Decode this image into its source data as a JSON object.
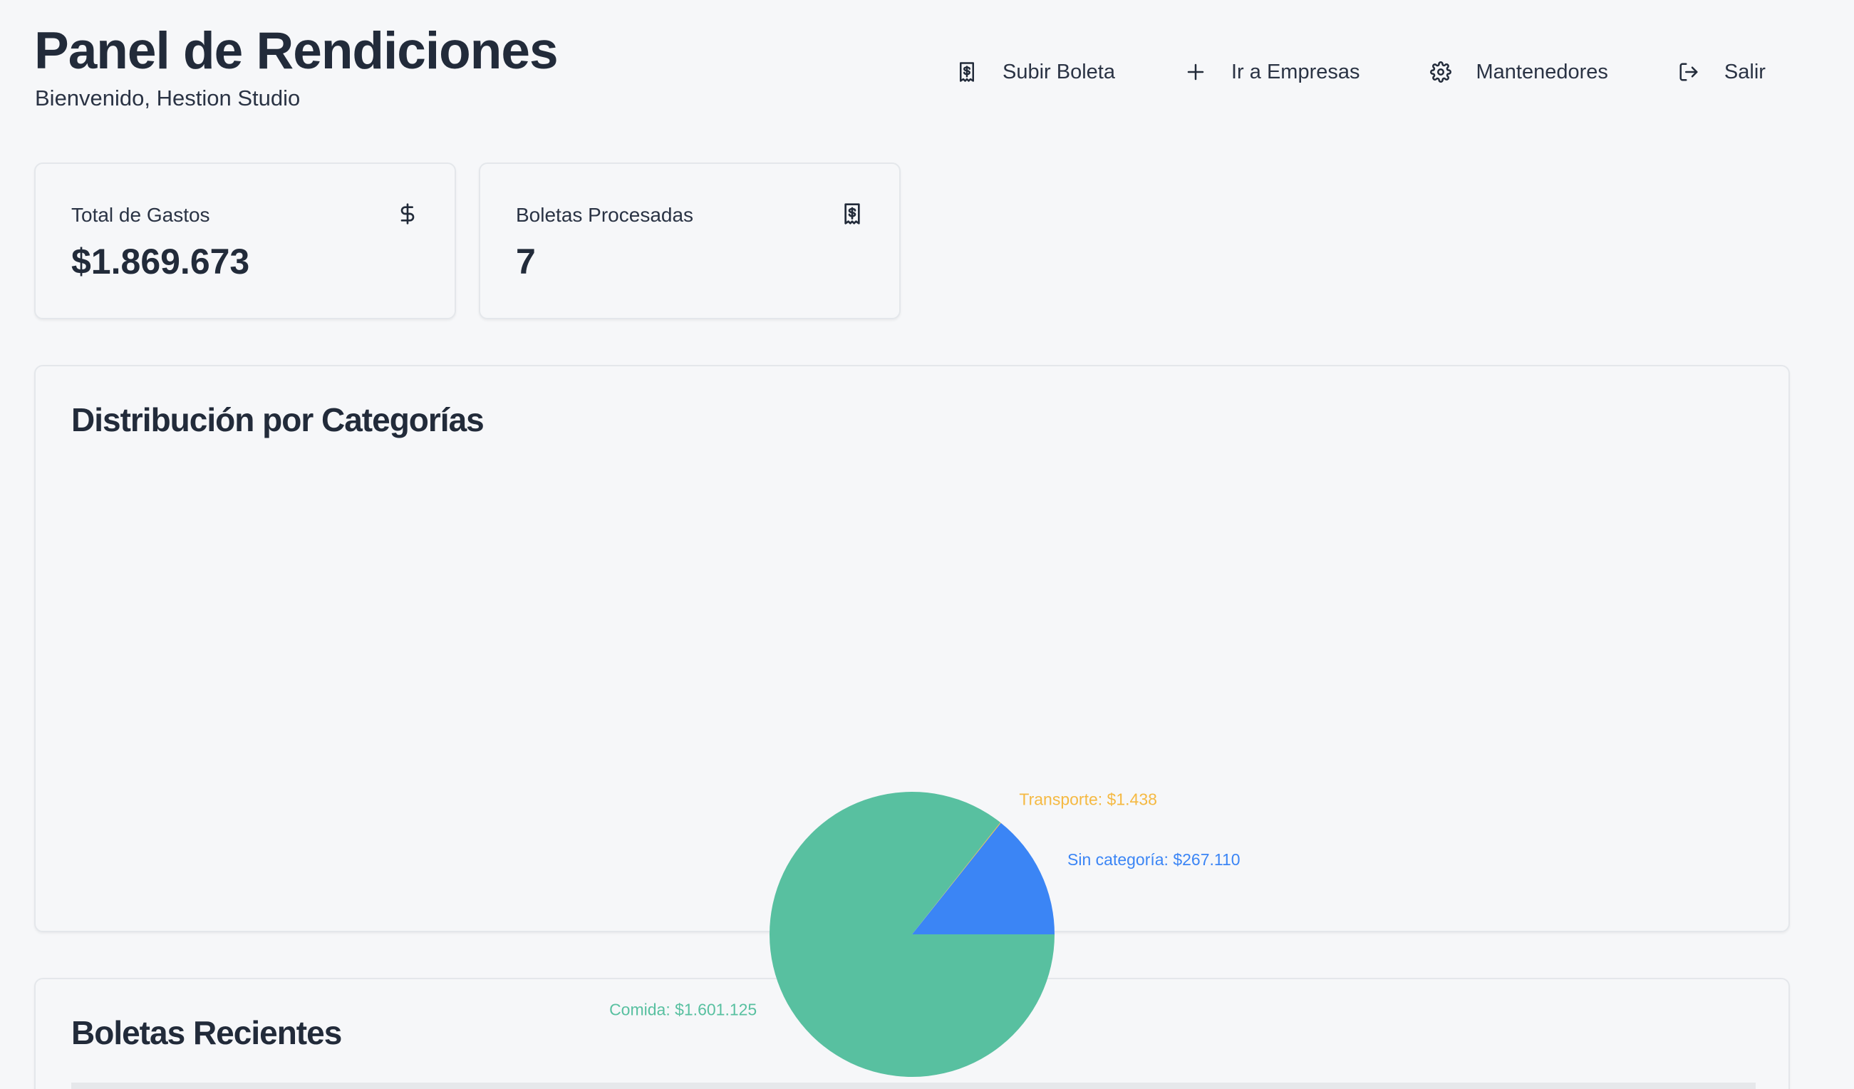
{
  "header": {
    "title": "Panel de Rendiciones",
    "subtitle": "Bienvenido, Hestion Studio"
  },
  "nav": {
    "upload_label": "Subir Boleta",
    "upload_icon": "receipt-dollar-icon",
    "companies_label": "Ir a Empresas",
    "companies_icon": "plus-icon",
    "maintainers_label": "Mantenedores",
    "maintainers_icon": "gear-icon",
    "logout_label": "Salir",
    "logout_icon": "logout-icon"
  },
  "stats": {
    "total": {
      "label": "Total de Gastos",
      "value": "$1.869.673",
      "icon": "dollar-icon"
    },
    "count": {
      "label": "Boletas Procesadas",
      "value": "7",
      "icon": "receipt-dollar-icon"
    }
  },
  "chart_section": {
    "title": "Distribución por Categorías"
  },
  "recent_section": {
    "title": "Boletas Recientes"
  },
  "colors": {
    "comida": "#58c0a0",
    "sin_categoria": "#3b85f5",
    "transporte": "#f5b942"
  },
  "chart_data": {
    "type": "pie",
    "title": "Distribución por Categorías",
    "slices": [
      {
        "label": "Sin categoría: $267.110",
        "name": "Sin categoría",
        "value": 267110,
        "color": "#3b85f5"
      },
      {
        "label": "Transporte: $1.438",
        "name": "Transporte",
        "value": 1438,
        "color": "#f5b942"
      },
      {
        "label": "Comida: $1.601.125",
        "name": "Comida",
        "value": 1601125,
        "color": "#58c0a0"
      }
    ],
    "legend": "none"
  }
}
